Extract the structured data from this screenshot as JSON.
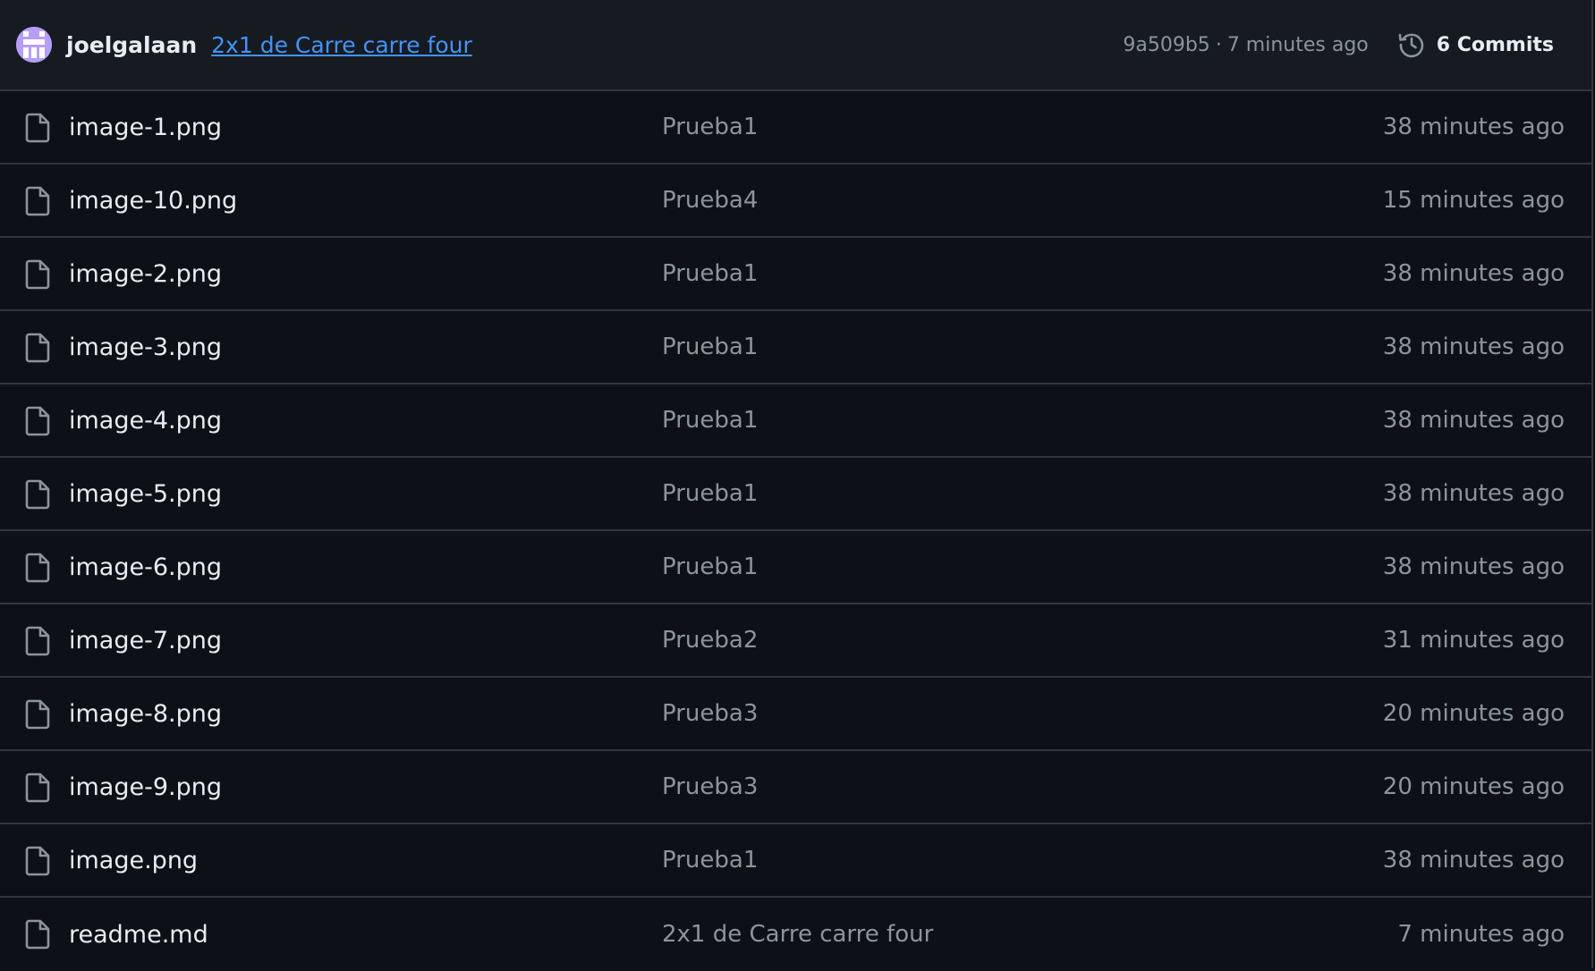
{
  "header": {
    "author": "joelgalaan",
    "commit_message": "2x1 de Carre carre four",
    "commit_hash": "9a509b5",
    "separator": "·",
    "commit_time": "7 minutes ago",
    "commits_label": "6 Commits"
  },
  "files": [
    {
      "name": "image-1.png",
      "message": "Prueba1",
      "time": "38 minutes ago"
    },
    {
      "name": "image-10.png",
      "message": "Prueba4",
      "time": "15 minutes ago"
    },
    {
      "name": "image-2.png",
      "message": "Prueba1",
      "time": "38 minutes ago"
    },
    {
      "name": "image-3.png",
      "message": "Prueba1",
      "time": "38 minutes ago"
    },
    {
      "name": "image-4.png",
      "message": "Prueba1",
      "time": "38 minutes ago"
    },
    {
      "name": "image-5.png",
      "message": "Prueba1",
      "time": "38 minutes ago"
    },
    {
      "name": "image-6.png",
      "message": "Prueba1",
      "time": "38 minutes ago"
    },
    {
      "name": "image-7.png",
      "message": "Prueba2",
      "time": "31 minutes ago"
    },
    {
      "name": "image-8.png",
      "message": "Prueba3",
      "time": "20 minutes ago"
    },
    {
      "name": "image-9.png",
      "message": "Prueba3",
      "time": "20 minutes ago"
    },
    {
      "name": "image.png",
      "message": "Prueba1",
      "time": "38 minutes ago"
    },
    {
      "name": "readme.md",
      "message": "2x1 de Carre carre four",
      "time": "7 minutes ago"
    }
  ],
  "icons": {
    "avatar": "identicon-avatar",
    "history": "history-icon",
    "file": "file-icon"
  },
  "colors": {
    "background": "#0d1117",
    "header_background": "#161b22",
    "border": "#30363d",
    "text_primary": "#e6edf3",
    "text_muted": "#8b949e",
    "link": "#4493f8",
    "avatar": "#b69df8"
  }
}
